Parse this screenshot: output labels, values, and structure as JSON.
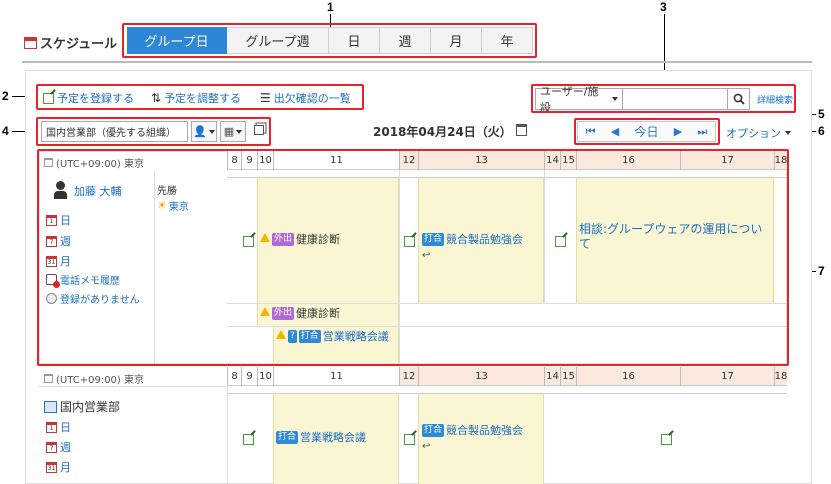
{
  "callouts": [
    "1",
    "2",
    "3",
    "4",
    "5",
    "6",
    "7"
  ],
  "app": {
    "title": "スケジュール"
  },
  "tabs": [
    "グループ日",
    "グループ週",
    "日",
    "週",
    "月",
    "年"
  ],
  "actions": {
    "register": "予定を登録する",
    "adjust": "予定を調整する",
    "attendance": "出欠確認の一覧"
  },
  "search": {
    "scope": "ユーザー/施設",
    "detail": "詳細検索"
  },
  "group_selector": "国内営業部（優先する組織）",
  "date_title": "2018年04月24日（火）",
  "nav": {
    "today": "今日"
  },
  "options": "オプション",
  "timezone": "(UTC+09:00) 東京",
  "hours": [
    "8",
    "9",
    "10",
    "11",
    "12",
    "13",
    "14",
    "15",
    "16",
    "17",
    "18"
  ],
  "user": {
    "name": "加藤 大輔",
    "links": [
      "日",
      "週",
      "月"
    ],
    "memo": "電話メモ履歴",
    "no_reg": "登録がありません",
    "note_label": "先勝",
    "weather": "東京"
  },
  "events1": {
    "health": "健康診断",
    "out_badge": "外出",
    "meet_badge": "打合",
    "study": "競合製品勉強会",
    "consult": "相談:グループウェアの運用について",
    "health2": "健康診断",
    "strategy": "営業戦略会議"
  },
  "group": {
    "name": "国内営業部",
    "links": [
      "日",
      "週",
      "月"
    ],
    "strategy": "営業戦略会議",
    "study": "競合製品勉強会"
  }
}
